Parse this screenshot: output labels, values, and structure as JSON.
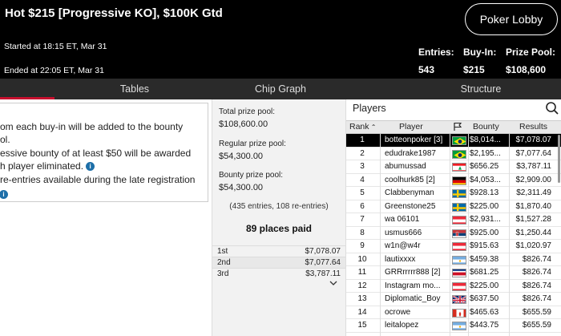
{
  "header": {
    "title": "Hot $215 [Progressive KO], $100K Gtd",
    "lobby_button": "Poker Lobby",
    "started": "Started at 18:15 ET, Mar 31",
    "ended": "Ended at 22:05 ET, Mar 31",
    "stats": {
      "entries_label": "Entries:",
      "entries_value": "543",
      "buyin_label": "Buy-In:",
      "buyin_value": "$215",
      "prizepool_label": "Prize Pool:",
      "prizepool_value": "$108,600"
    }
  },
  "tabs": {
    "tables": "Tables",
    "chip_graph": "Chip Graph",
    "structure": "Structure"
  },
  "info": {
    "line1": "om each buy-in will be added to the bounty",
    "line2": "ol.",
    "line3": "essive bounty of at least $50 will be awarded",
    "line4": "h player eliminated.",
    "line5": "re-entries available during the late registration",
    "info_glyph": "i"
  },
  "pool": {
    "total_label": "Total prize pool:",
    "total_value": "$108,600.00",
    "regular_label": "Regular prize pool:",
    "regular_value": "$54,300.00",
    "bounty_label": "Bounty prize pool:",
    "bounty_value": "$54,300.00",
    "entries_note": "(435 entries, 108 re-entries)",
    "places_paid": "89 places paid",
    "payouts": [
      {
        "place": "1st",
        "amount": "$7,078.07"
      },
      {
        "place": "2nd",
        "amount": "$7,077.64"
      },
      {
        "place": "3rd",
        "amount": "$3,787.11"
      }
    ]
  },
  "players": {
    "title": "Players",
    "columns": {
      "rank": "Rank",
      "player": "Player",
      "bounty": "Bounty",
      "results": "Results"
    },
    "rows": [
      {
        "rank": "1",
        "name": "botteonpoker [3]",
        "bounty": "$8,014...",
        "result": "$7,078.07",
        "flag": "brazil",
        "selected": true
      },
      {
        "rank": "2",
        "name": "edudrake1987",
        "bounty": "$2,195...",
        "result": "$7,077.64",
        "flag": "brazil"
      },
      {
        "rank": "3",
        "name": "abumussad",
        "bounty": "$656.25",
        "result": "$3,787.11",
        "flag": "lebanon"
      },
      {
        "rank": "4",
        "name": "coolhurk85 [2]",
        "bounty": "$4,053...",
        "result": "$2,909.00",
        "flag": "germany"
      },
      {
        "rank": "5",
        "name": "Clabbenyman",
        "bounty": "$928.13",
        "result": "$2,311.49",
        "flag": "sweden"
      },
      {
        "rank": "6",
        "name": "Greenstone25",
        "bounty": "$225.00",
        "result": "$1,870.40",
        "flag": "sweden"
      },
      {
        "rank": "7",
        "name": "wa 06101",
        "bounty": "$2,931...",
        "result": "$1,527.28",
        "flag": "austria"
      },
      {
        "rank": "8",
        "name": "usmus666",
        "bounty": "$925.00",
        "result": "$1,250.44",
        "flag": "serbia"
      },
      {
        "rank": "9",
        "name": "w1n@w4r",
        "bounty": "$915.63",
        "result": "$1,020.97",
        "flag": "austria"
      },
      {
        "rank": "10",
        "name": "lautixxxx",
        "bounty": "$459.38",
        "result": "$826.74",
        "flag": "argentina"
      },
      {
        "rank": "11",
        "name": "GRRrrrrr888 [2]",
        "bounty": "$681.25",
        "result": "$826.74",
        "flag": "costarica"
      },
      {
        "rank": "12",
        "name": "Instagram mo...",
        "bounty": "$225.00",
        "result": "$826.74",
        "flag": "austria"
      },
      {
        "rank": "13",
        "name": "Diplomatic_Boy",
        "bounty": "$637.50",
        "result": "$826.74",
        "flag": "uk"
      },
      {
        "rank": "14",
        "name": "ocrowe",
        "bounty": "$465.63",
        "result": "$655.59",
        "flag": "canada"
      },
      {
        "rank": "15",
        "name": "leitalopez",
        "bounty": "$443.75",
        "result": "$655.59",
        "flag": "argentina"
      }
    ]
  },
  "colors": {
    "accent_red": "#c8102e",
    "selected_row": "#000000",
    "info_blue": "#1e6fa8"
  }
}
